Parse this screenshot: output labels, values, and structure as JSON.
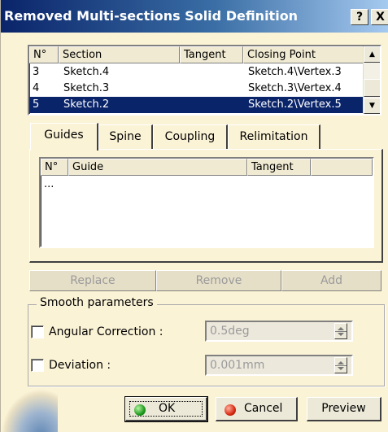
{
  "window": {
    "title": "Removed Multi-sections Solid Definition",
    "help_label": "?",
    "close_label": "X"
  },
  "sections": {
    "columns": [
      "N°",
      "Section",
      "Tangent",
      "Closing Point"
    ],
    "rows": [
      {
        "num": "3",
        "section": "Sketch.4",
        "tangent": "",
        "closing": "Sketch.4\\Vertex.3"
      },
      {
        "num": "4",
        "section": "Sketch.3",
        "tangent": "",
        "closing": "Sketch.3\\Vertex.4"
      },
      {
        "num": "5",
        "section": "Sketch.2",
        "tangent": "",
        "closing": "Sketch.2\\Vertex.5"
      }
    ],
    "selected_index": 2,
    "scroll_up_icon": "arrow-up-icon",
    "scroll_down_icon": "arrow-down-icon"
  },
  "tabs": [
    {
      "label": "Guides",
      "active": true
    },
    {
      "label": "Spine",
      "active": false
    },
    {
      "label": "Coupling",
      "active": false
    },
    {
      "label": "Relimitation",
      "active": false
    }
  ],
  "guides": {
    "columns": [
      "N°",
      "Guide",
      "Tangent"
    ],
    "rows": [
      "..."
    ]
  },
  "actions": {
    "replace_label": "Replace",
    "remove_label": "Remove",
    "add_label": "Add"
  },
  "smooth": {
    "group_label": "Smooth parameters",
    "angular_label": "Angular Correction :",
    "angular_value": "0.5deg",
    "angular_checked": false,
    "deviation_label": "Deviation :",
    "deviation_value": "0.001mm",
    "deviation_checked": false
  },
  "buttons": {
    "ok_label": "OK",
    "cancel_label": "Cancel",
    "preview_label": "Preview"
  },
  "colors": {
    "title_start": "#0a246a",
    "panel_bg": "#fbf3d6",
    "selection": "#0a246a"
  }
}
